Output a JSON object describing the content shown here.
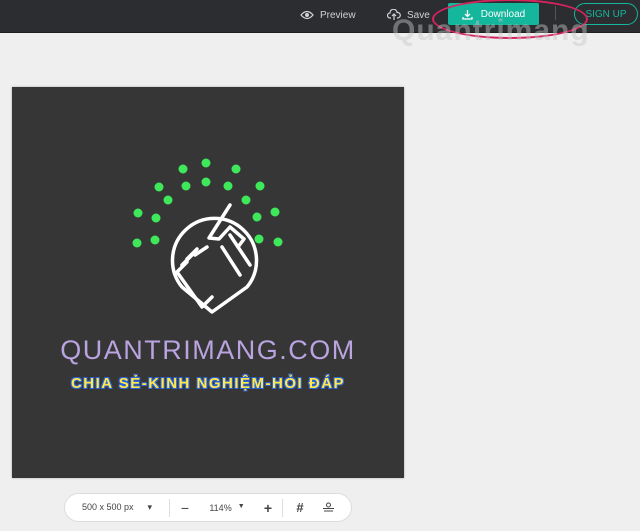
{
  "topbar": {
    "preview_label": "Preview",
    "save_label": "Save",
    "download_label": "Download",
    "signup_label": "SIGN UP"
  },
  "watermark": "Quantrimang",
  "design": {
    "title": "QUANTRIMANG.COM",
    "subtitle": "CHIA SẺ-KINH NGHIỆM-HỎI ĐÁP",
    "dot_color": "#3ee85a",
    "background": "#363636"
  },
  "toolbar": {
    "size": "500 x 500 px",
    "zoom": "114%"
  }
}
